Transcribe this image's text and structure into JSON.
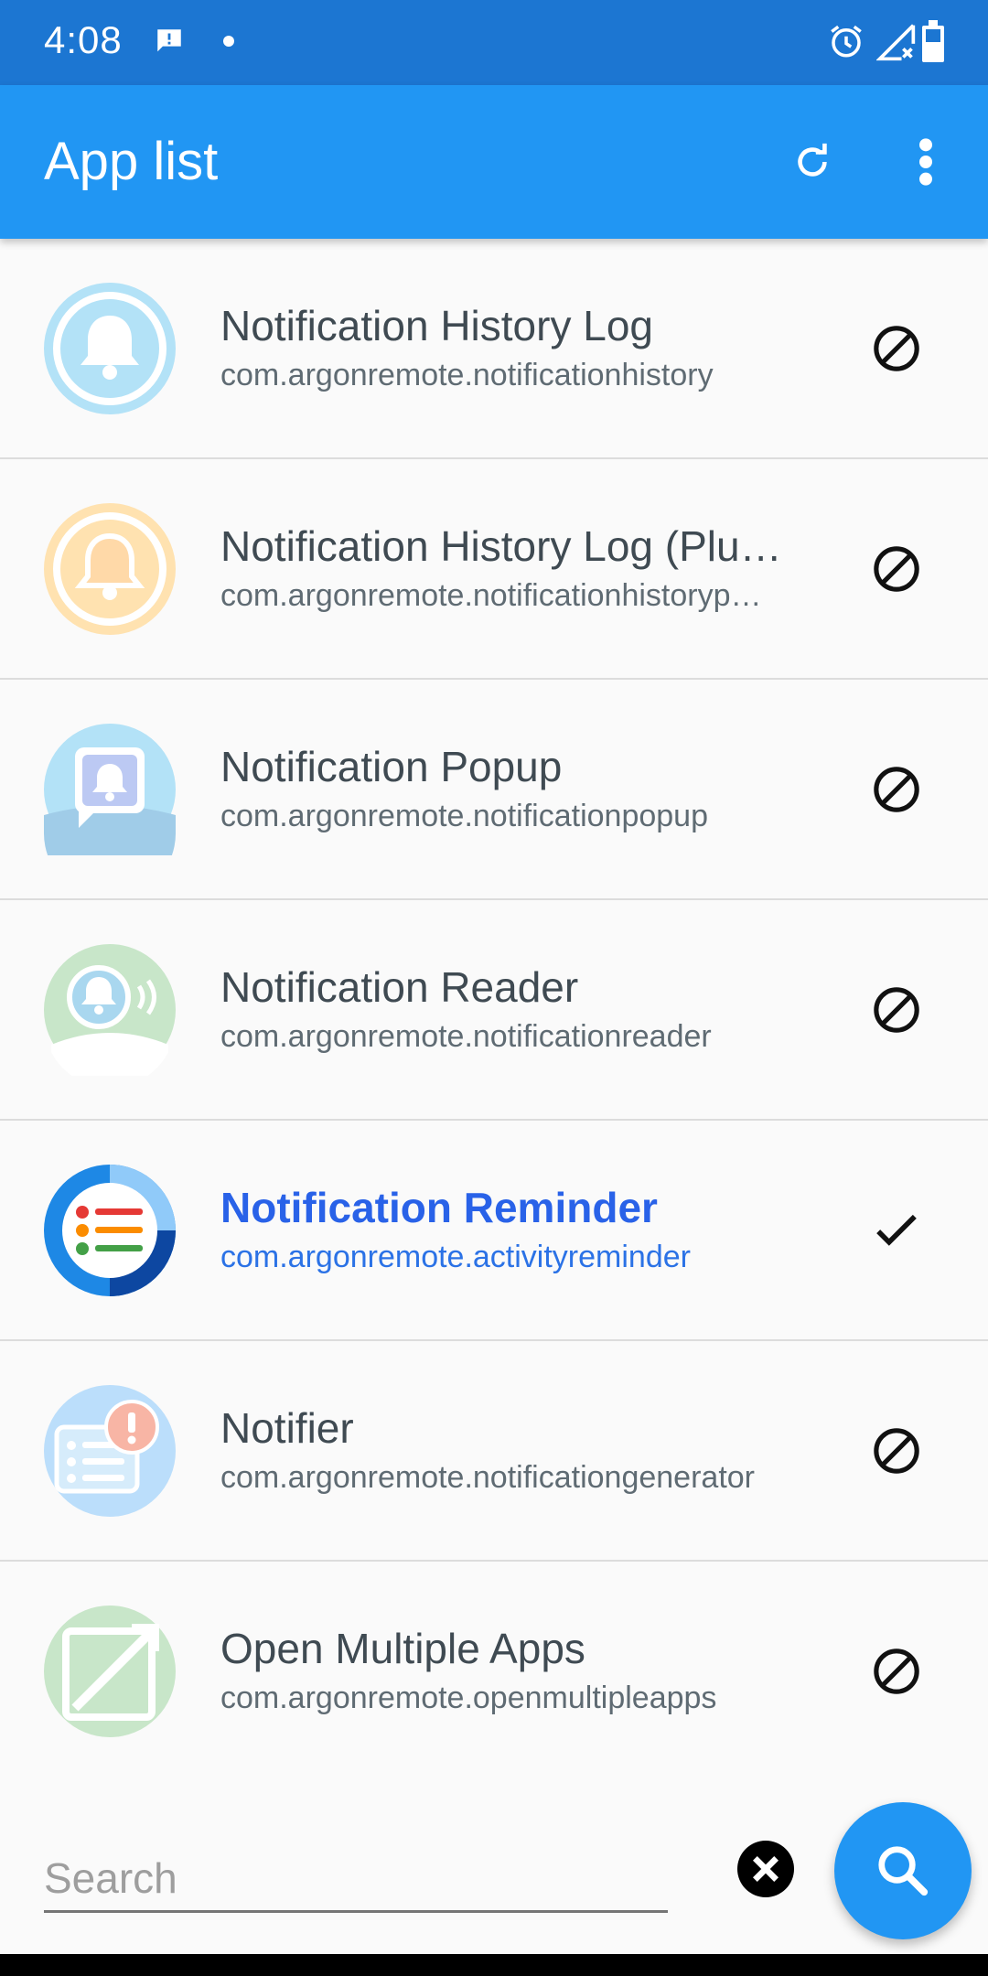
{
  "status_bar": {
    "time": "4:08"
  },
  "app_bar": {
    "title": "App list"
  },
  "apps": [
    {
      "name": "Notification History Log",
      "package": "com.argonremote.notificationhistory",
      "state": "disabled"
    },
    {
      "name": "Notification History Log (Plu…",
      "package": "com.argonremote.notificationhistoryp…",
      "state": "disabled"
    },
    {
      "name": "Notification Popup",
      "package": "com.argonremote.notificationpopup",
      "state": "disabled"
    },
    {
      "name": "Notification Reader",
      "package": "com.argonremote.notificationreader",
      "state": "disabled"
    },
    {
      "name": "Notification Reminder",
      "package": "com.argonremote.activityreminder",
      "state": "selected"
    },
    {
      "name": "Notifier",
      "package": "com.argonremote.notificationgenerator",
      "state": "disabled"
    },
    {
      "name": "Open Multiple Apps",
      "package": "com.argonremote.openmultipleapps",
      "state": "disabled"
    }
  ],
  "search": {
    "placeholder": "Search"
  },
  "colors": {
    "status_bar": "#1c76d2",
    "app_bar": "#2196f3",
    "selected_text": "#2962e8"
  }
}
